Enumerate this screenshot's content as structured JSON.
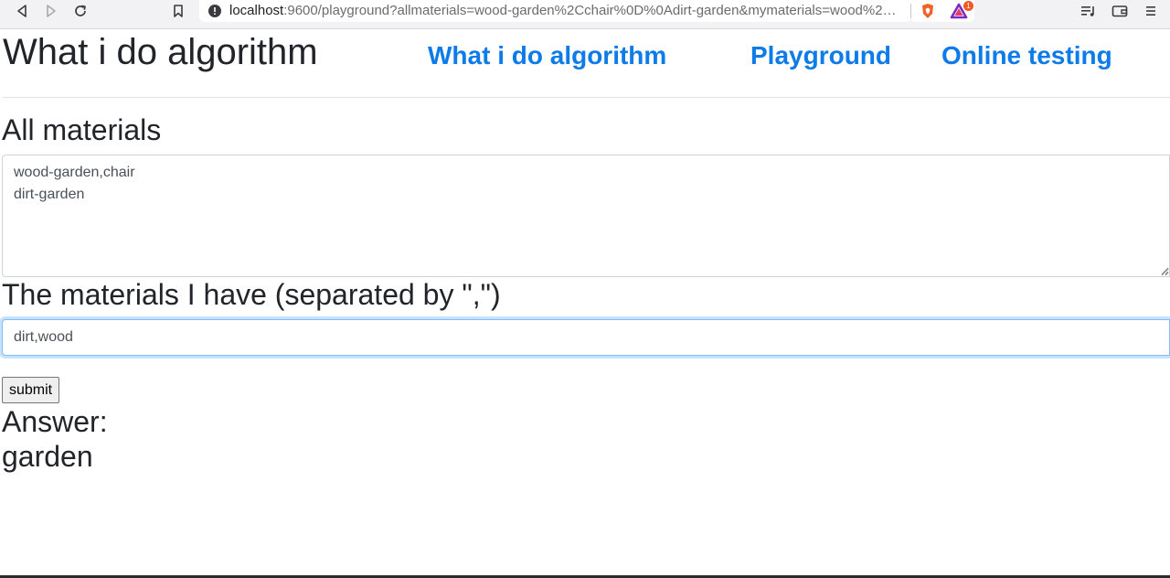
{
  "browser": {
    "url_host": "localhost",
    "url_rest": ":9600/playground?allmaterials=wood-garden%2Cchair%0D%0Adirt-garden&mymaterials=wood%2…",
    "notification_count": "1"
  },
  "header": {
    "title": "What i do algorithm",
    "nav": [
      {
        "label": "What i do algorithm"
      },
      {
        "label": "Playground"
      },
      {
        "label": "Online testing"
      }
    ]
  },
  "form": {
    "all_materials_heading": "All materials",
    "all_materials_value": "wood-garden,chair\ndirt-garden",
    "have_heading": "The materials I have (separated by \",\")",
    "have_value": "dirt,wood",
    "submit_label": "submit"
  },
  "answer": {
    "label": "Answer:",
    "value": "garden"
  },
  "colors": {
    "link": "#0d7be8",
    "text": "#212529",
    "focus_border": "#80bdff"
  }
}
